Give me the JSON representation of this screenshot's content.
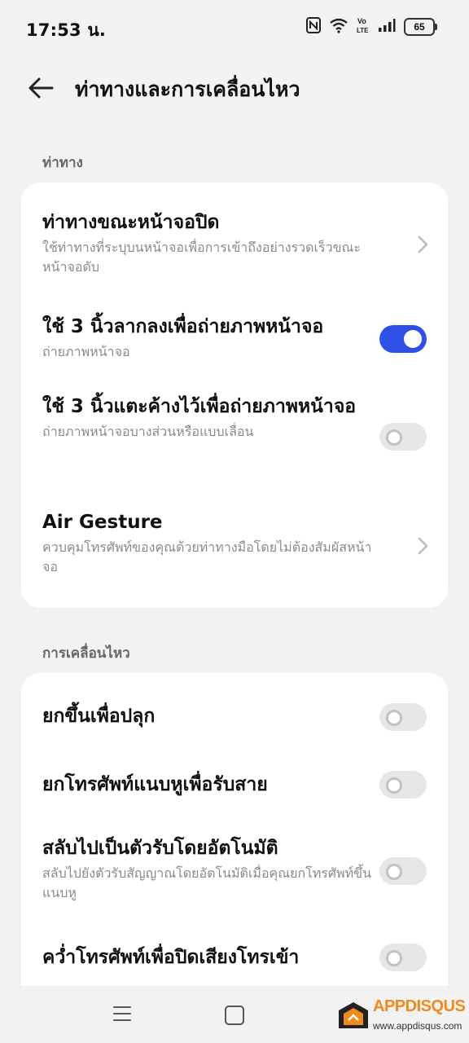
{
  "status_bar": {
    "time": "17:53 น.",
    "battery": "65",
    "network": "VoLTE",
    "icons": [
      "nfc-icon",
      "wifi-icon",
      "volte-icon",
      "signal-icon",
      "battery-icon"
    ]
  },
  "header": {
    "title": "ท่าทางและการเคลื่อนไหว",
    "back_icon": "arrow-left-icon"
  },
  "sections": [
    {
      "label": "ท่าทาง",
      "items": [
        {
          "title": "ท่าทางขณะหน้าจอปิด",
          "description": "ใช้ท่าทางที่ระบุบนหน้าจอเพื่อการเข้าถึงอย่างรวดเร็วขณะหน้าจอดับ",
          "control": "chevron"
        },
        {
          "title": "ใช้ 3 นิ้วลากลงเพื่อถ่ายภาพหน้าจอ",
          "description": "ถ่ายภาพหน้าจอ",
          "control": "toggle",
          "enabled": true
        },
        {
          "title": "ใช้ 3 นิ้วแตะค้างไว้เพื่อถ่ายภาพหน้าจอ",
          "description": "ถ่ายภาพหน้าจอบางส่วนหรือแบบเลื่อน",
          "control": "toggle",
          "enabled": false
        },
        {
          "title": "Air Gesture",
          "description": "ควบคุมโทรศัพท์ของคุณด้วยท่าทางมือโดยไม่ต้องสัมผัสหน้าจอ",
          "control": "chevron"
        }
      ]
    },
    {
      "label": "การเคลื่อนไหว",
      "items": [
        {
          "title": "ยกขึ้นเพื่อปลุก",
          "control": "toggle",
          "enabled": false
        },
        {
          "title": "ยกโทรศัพท์แนบหูเพื่อรับสาย",
          "control": "toggle",
          "enabled": false
        },
        {
          "title": "สลับไปเป็นตัวรับโดยอัตโนมัติ",
          "description": "สลับไปยังตัวรับสัญญาณโดยอัตโนมัติเมื่อคุณยกโทรศัพท์ขึ้นแนบหู",
          "control": "toggle",
          "enabled": false
        },
        {
          "title": "คว่ำโทรศัพท์เพื่อปิดเสียงโทรเข้า",
          "control": "toggle",
          "enabled": false
        }
      ]
    }
  ],
  "nav_bar": {
    "buttons": [
      "menu-icon",
      "home-icon"
    ]
  },
  "watermark": {
    "brand": "APPDISQUS",
    "url": "www.appdisqus.com"
  },
  "colors": {
    "background": "#f2f2f2",
    "card": "#ffffff",
    "accent": "#2f50e8",
    "toggle_off": "#e6e6e6",
    "secondary_text": "#8a8a8a"
  }
}
